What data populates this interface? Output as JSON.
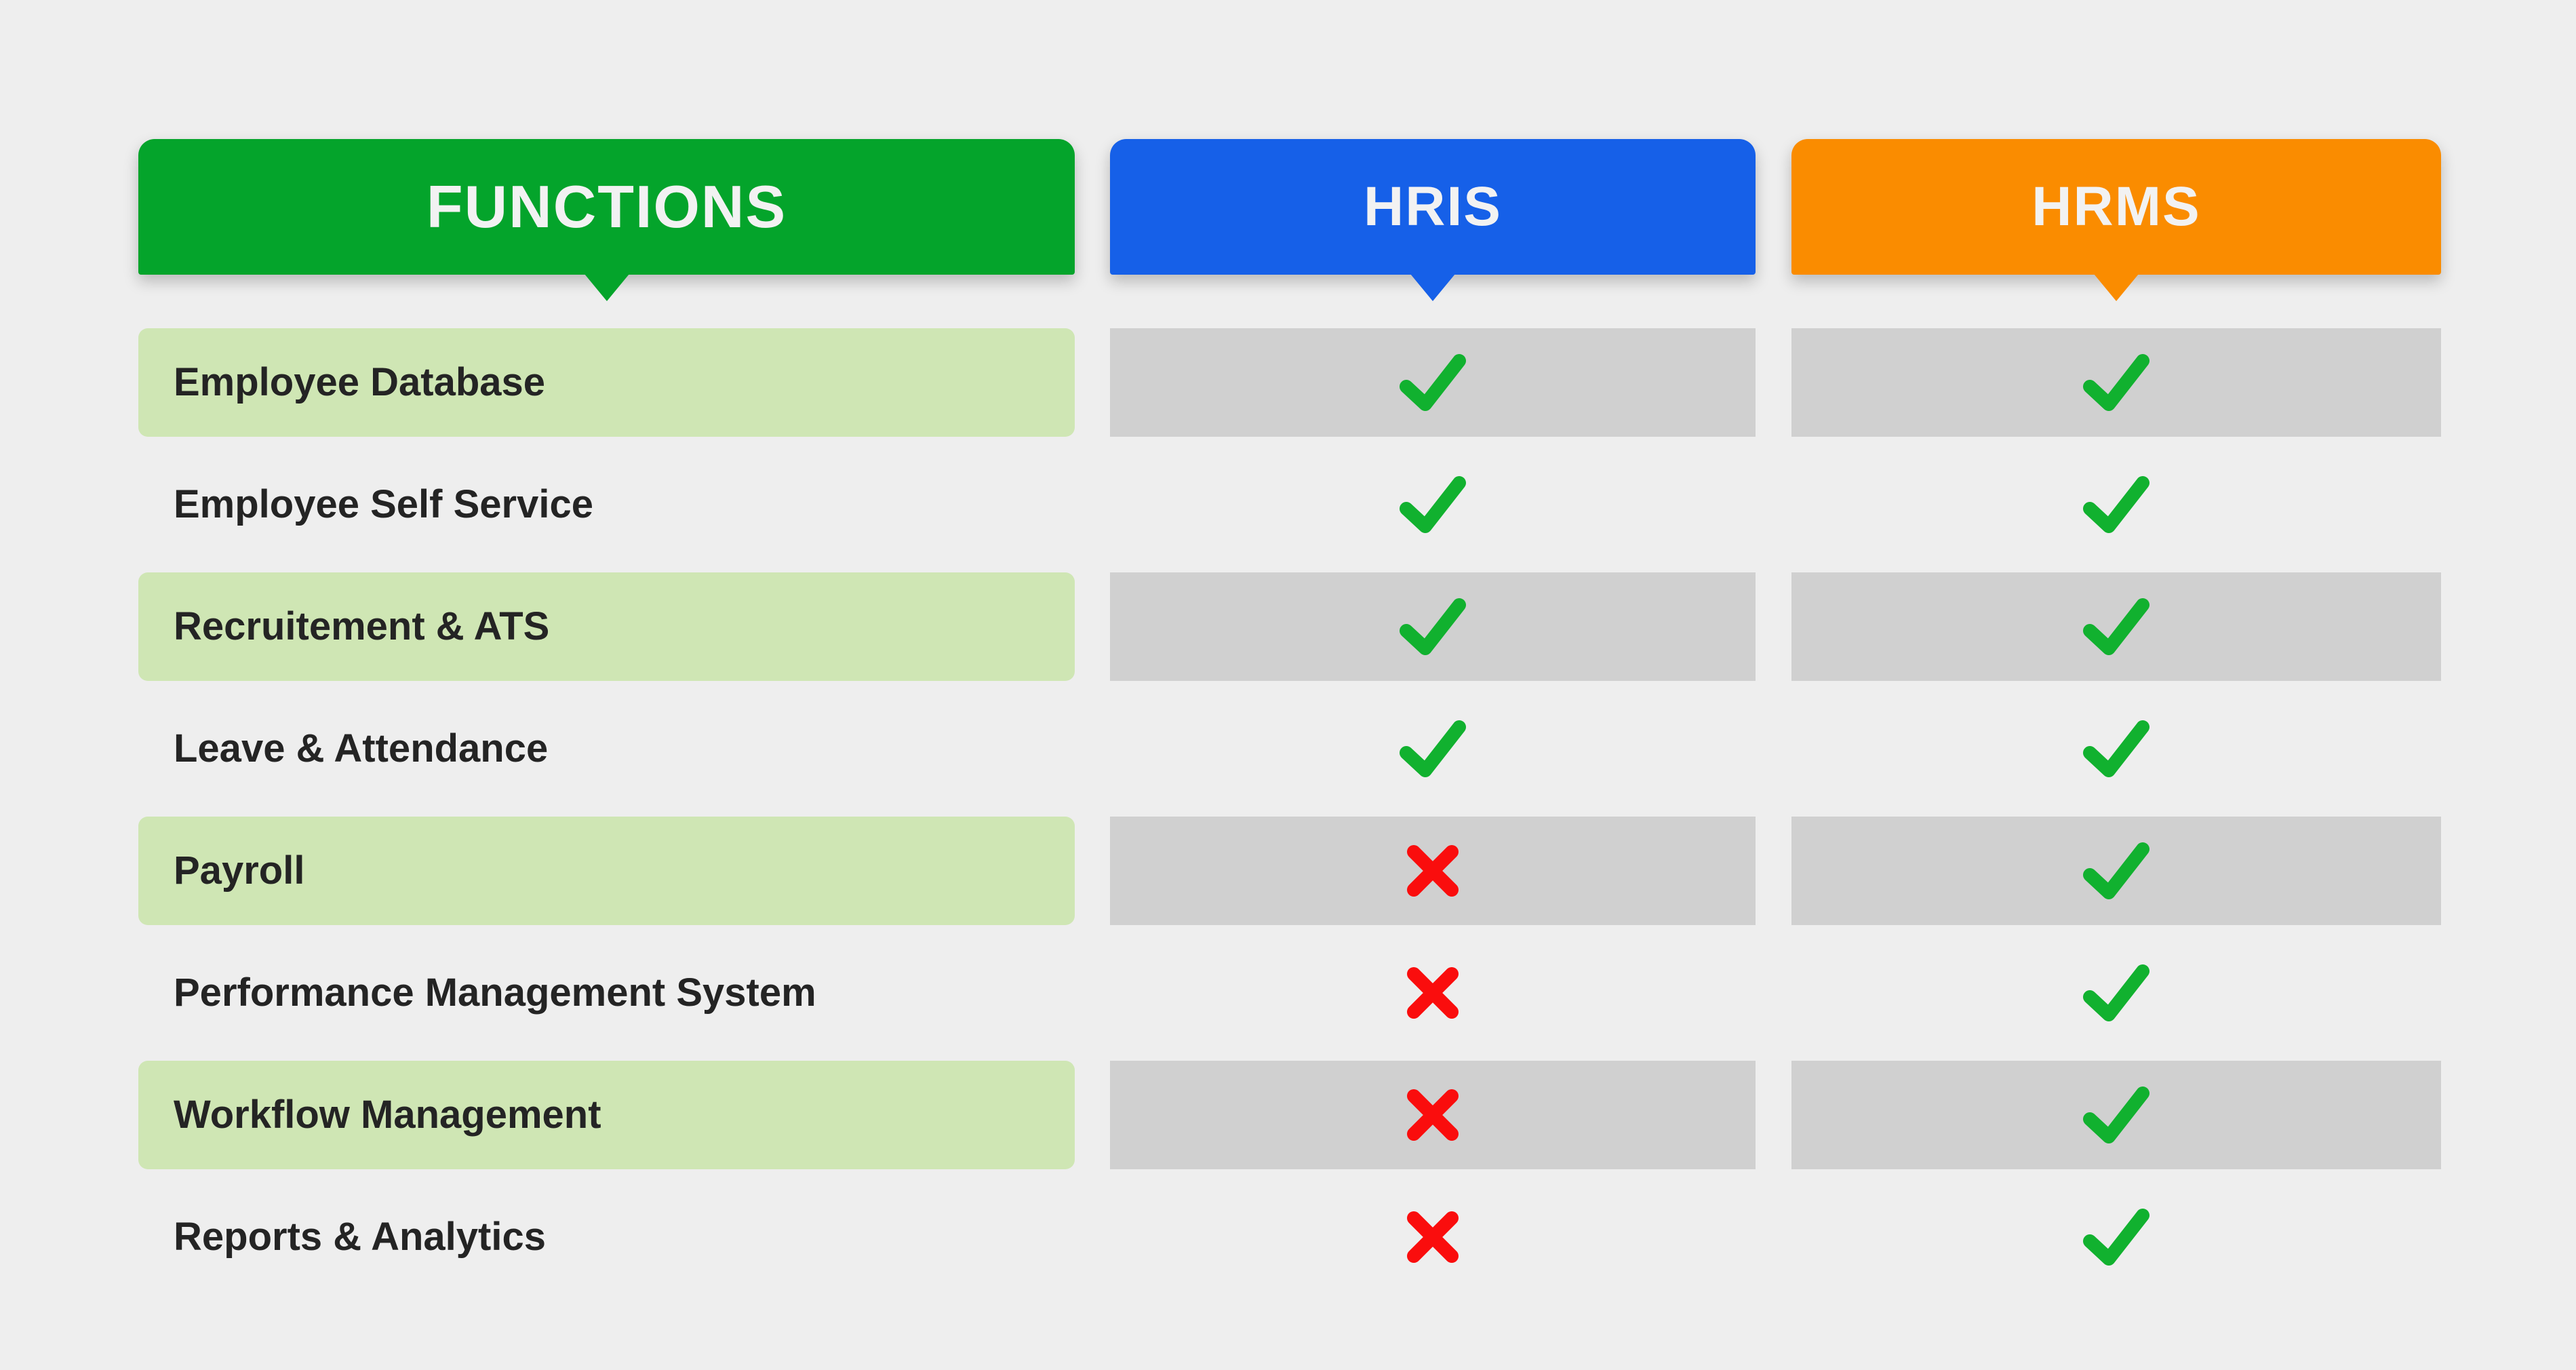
{
  "page": {
    "background_color": "#eeeeee"
  },
  "headers": [
    {
      "id": "functions",
      "label": "FUNCTIONS",
      "color": "#04a42b"
    },
    {
      "id": "hris",
      "label": "HRIS",
      "color": "#1660e8"
    },
    {
      "id": "hrms",
      "label": "HRMS",
      "color": "#fa8c00"
    }
  ],
  "colors": {
    "header_green": "#04a42b",
    "header_blue": "#1660e8",
    "header_orange": "#fa8c00",
    "row_band_green": "#cfe6b4",
    "row_band_grey": "#d0d0d0",
    "check_green": "#11b12f",
    "cross_red": "#fa0d0d",
    "label_text": "#242424",
    "header_text": "#f2f2f2"
  },
  "icons": {
    "check": "check-icon",
    "cross": "cross-icon"
  },
  "table": {
    "columns": [
      "FUNCTIONS",
      "HRIS",
      "HRMS"
    ],
    "rows": [
      {
        "function": "Employee Database",
        "hris": "check",
        "hrms": "check",
        "banded": true
      },
      {
        "function": "Employee Self Service",
        "hris": "check",
        "hrms": "check",
        "banded": false
      },
      {
        "function": "Recruitement & ATS",
        "hris": "check",
        "hrms": "check",
        "banded": true
      },
      {
        "function": "Leave & Attendance",
        "hris": "check",
        "hrms": "check",
        "banded": false
      },
      {
        "function": "Payroll",
        "hris": "cross",
        "hrms": "check",
        "banded": true
      },
      {
        "function": "Performance Management System",
        "hris": "cross",
        "hrms": "check",
        "banded": false
      },
      {
        "function": "Workflow Management",
        "hris": "cross",
        "hrms": "check",
        "banded": true
      },
      {
        "function": "Reports & Analytics",
        "hris": "cross",
        "hrms": "check",
        "banded": false
      }
    ]
  }
}
